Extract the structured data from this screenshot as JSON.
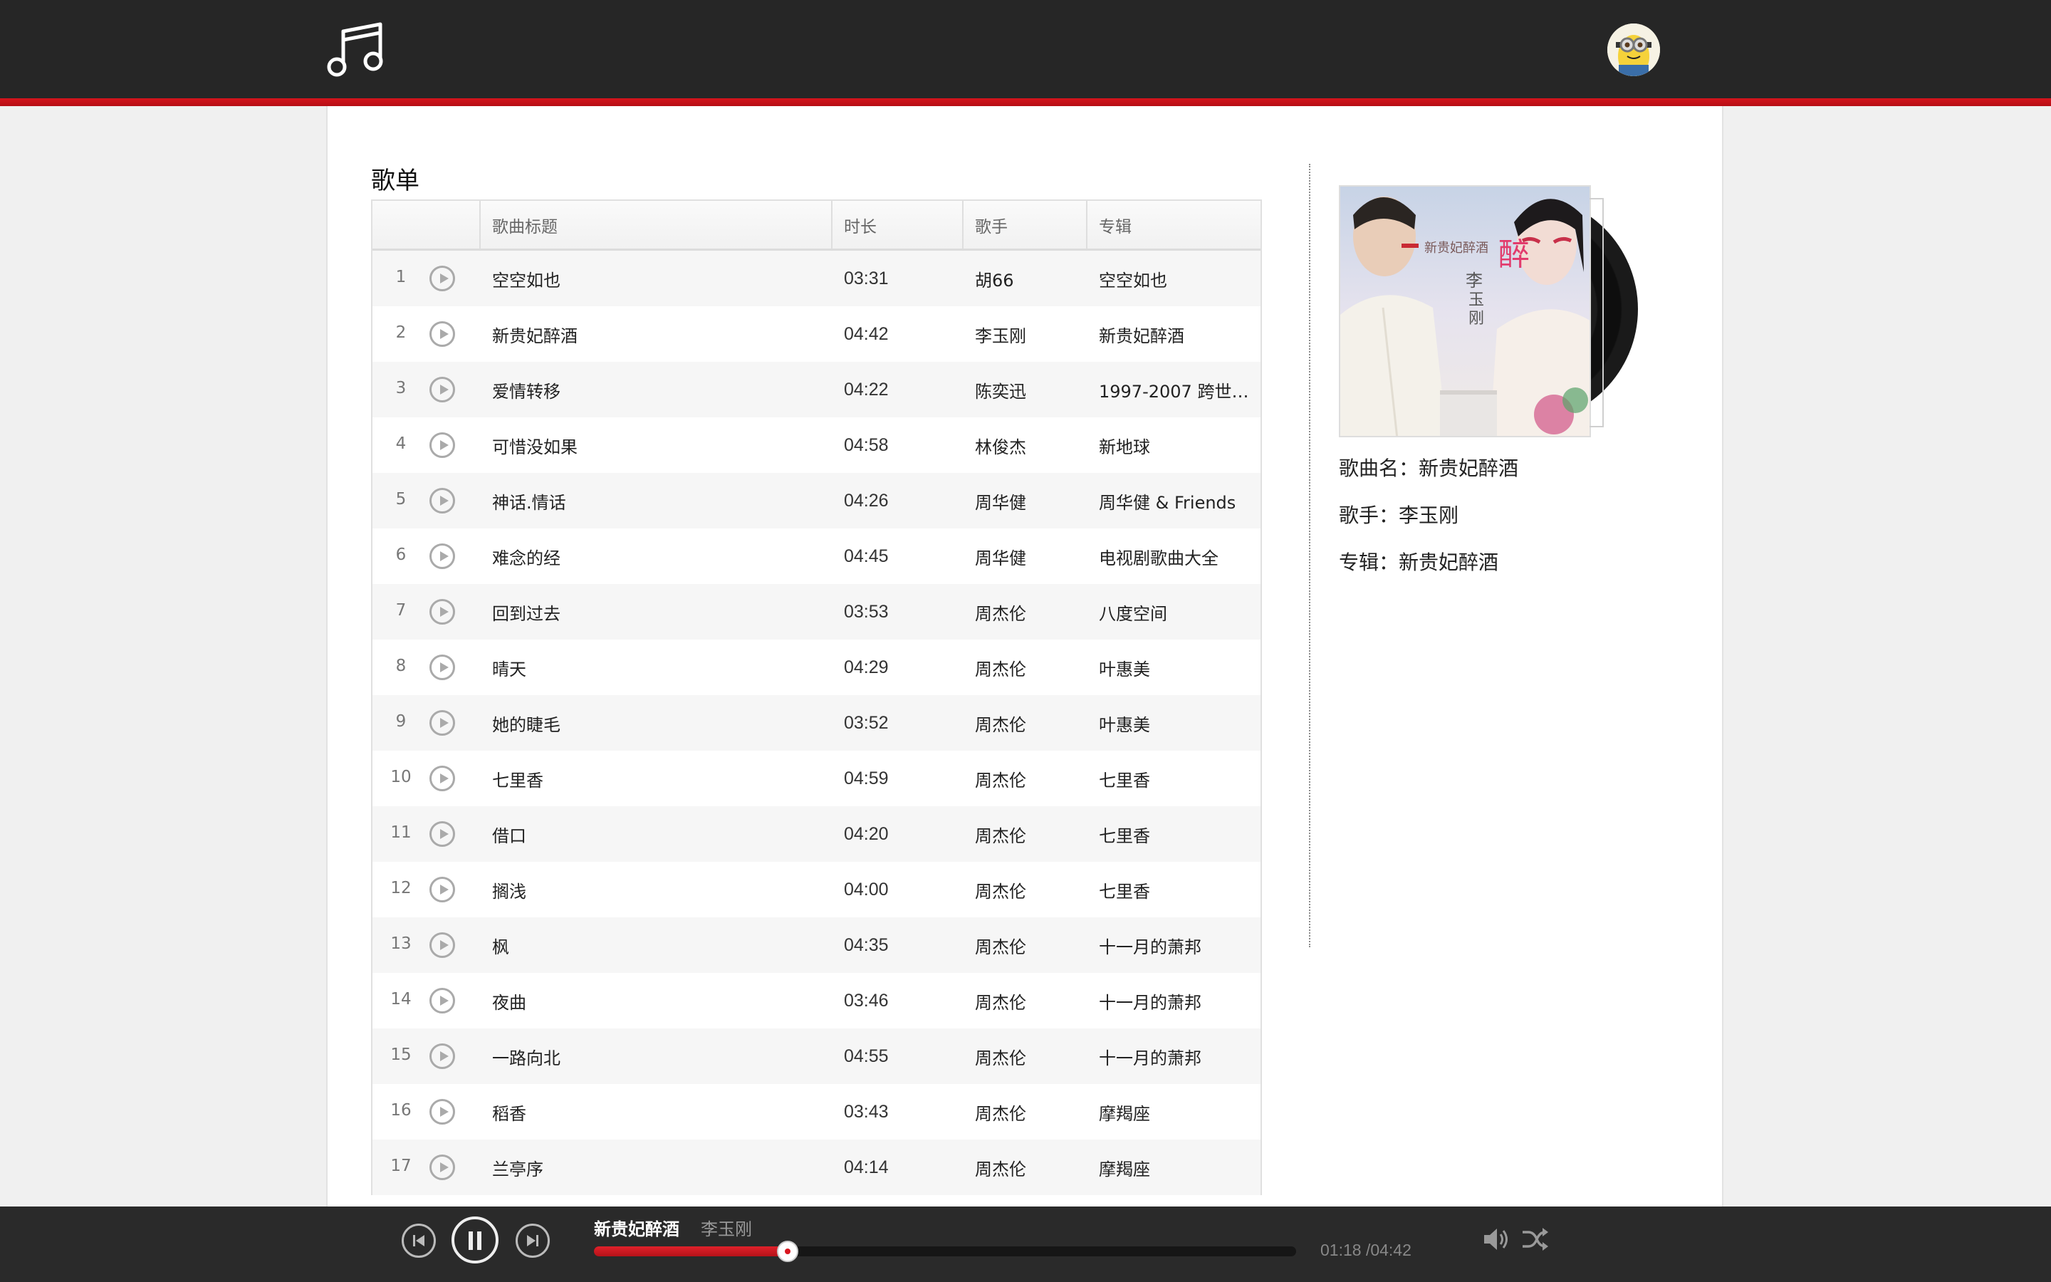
{
  "header": {
    "logo_icon": "music-note-icon",
    "avatar_icon": "minion-avatar"
  },
  "playlist": {
    "title": "歌单",
    "columns": [
      "",
      "歌曲标题",
      "时长",
      "歌手",
      "专辑"
    ],
    "songs": [
      {
        "index": "1",
        "title": "空空如也",
        "duration": "03:31",
        "artist": "胡66",
        "album": "空空如也"
      },
      {
        "index": "2",
        "title": "新贵妃醉酒",
        "duration": "04:42",
        "artist": "李玉刚",
        "album": "新贵妃醉酒"
      },
      {
        "index": "3",
        "title": "爱情转移",
        "duration": "04:22",
        "artist": "陈奕迅",
        "album": "1997-2007 跨世…"
      },
      {
        "index": "4",
        "title": "可惜没如果",
        "duration": "04:58",
        "artist": "林俊杰",
        "album": "新地球"
      },
      {
        "index": "5",
        "title": "神话.情话",
        "duration": "04:26",
        "artist": "周华健",
        "album": "周华健 & Friends"
      },
      {
        "index": "6",
        "title": "难念的经",
        "duration": "04:45",
        "artist": "周华健",
        "album": "电视剧歌曲大全"
      },
      {
        "index": "7",
        "title": "回到过去",
        "duration": "03:53",
        "artist": "周杰伦",
        "album": "八度空间"
      },
      {
        "index": "8",
        "title": "晴天",
        "duration": "04:29",
        "artist": "周杰伦",
        "album": "叶惠美"
      },
      {
        "index": "9",
        "title": "她的睫毛",
        "duration": "03:52",
        "artist": "周杰伦",
        "album": "叶惠美"
      },
      {
        "index": "10",
        "title": "七里香",
        "duration": "04:59",
        "artist": "周杰伦",
        "album": "七里香"
      },
      {
        "index": "11",
        "title": "借口",
        "duration": "04:20",
        "artist": "周杰伦",
        "album": "七里香"
      },
      {
        "index": "12",
        "title": "搁浅",
        "duration": "04:00",
        "artist": "周杰伦",
        "album": "七里香"
      },
      {
        "index": "13",
        "title": "枫",
        "duration": "04:35",
        "artist": "周杰伦",
        "album": "十一月的萧邦"
      },
      {
        "index": "14",
        "title": "夜曲",
        "duration": "03:46",
        "artist": "周杰伦",
        "album": "十一月的萧邦"
      },
      {
        "index": "15",
        "title": "一路向北",
        "duration": "04:55",
        "artist": "周杰伦",
        "album": "十一月的萧邦"
      },
      {
        "index": "16",
        "title": "稻香",
        "duration": "03:43",
        "artist": "周杰伦",
        "album": "摩羯座"
      },
      {
        "index": "17",
        "title": "兰亭序",
        "duration": "04:14",
        "artist": "周杰伦",
        "album": "摩羯座"
      }
    ]
  },
  "current": {
    "song_label": "歌曲名：",
    "song": "新贵妃醉酒",
    "artist_label": "歌手：",
    "artist": "李玉刚",
    "album_label": "专辑：",
    "album": "新贵妃醉酒",
    "cover_text_main": "李玉刚",
    "cover_text_title": "新贵妃醉酒"
  },
  "player": {
    "title": "新贵妃醉酒",
    "artist": "李玉刚",
    "time": "01:18 /04:42",
    "progress": 0.276,
    "icons": [
      "prev-icon",
      "pause-icon",
      "next-icon",
      "volume-icon",
      "shuffle-icon"
    ]
  },
  "colors": {
    "accent": "#d4141c",
    "topbar": "#262626",
    "player_bg": "#2a2a2a"
  }
}
